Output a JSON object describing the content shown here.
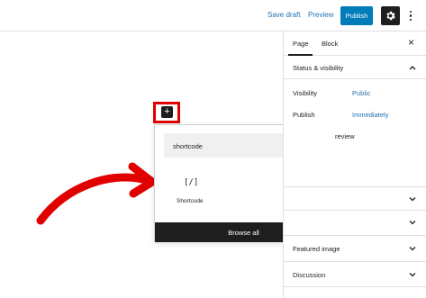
{
  "topbar": {
    "save_draft": "Save draft",
    "preview": "Preview",
    "publish": "Publish"
  },
  "sidebar": {
    "tabs": [
      {
        "label": "Page",
        "active": true
      },
      {
        "label": "Block",
        "active": false
      }
    ],
    "close": "×",
    "status_visibility": {
      "title": "Status & visibility",
      "rows": [
        {
          "label": "Visibility",
          "value": "Public"
        },
        {
          "label": "Publish",
          "value": "Immediately"
        }
      ],
      "partial_text": "review"
    },
    "panels": [
      {
        "title": ""
      },
      {
        "title": ""
      },
      {
        "title": "Featured image"
      },
      {
        "title": "Discussion"
      }
    ]
  },
  "inserter": {
    "search_value": "shortcode",
    "clear": "×",
    "results": [
      {
        "icon": "[/]",
        "label": "Shortcode"
      }
    ],
    "browse_all": "Browse all"
  },
  "colors": {
    "accent": "#007cba",
    "link": "#2271b1",
    "highlight": "#e00000",
    "dark": "#1e1e1e"
  }
}
